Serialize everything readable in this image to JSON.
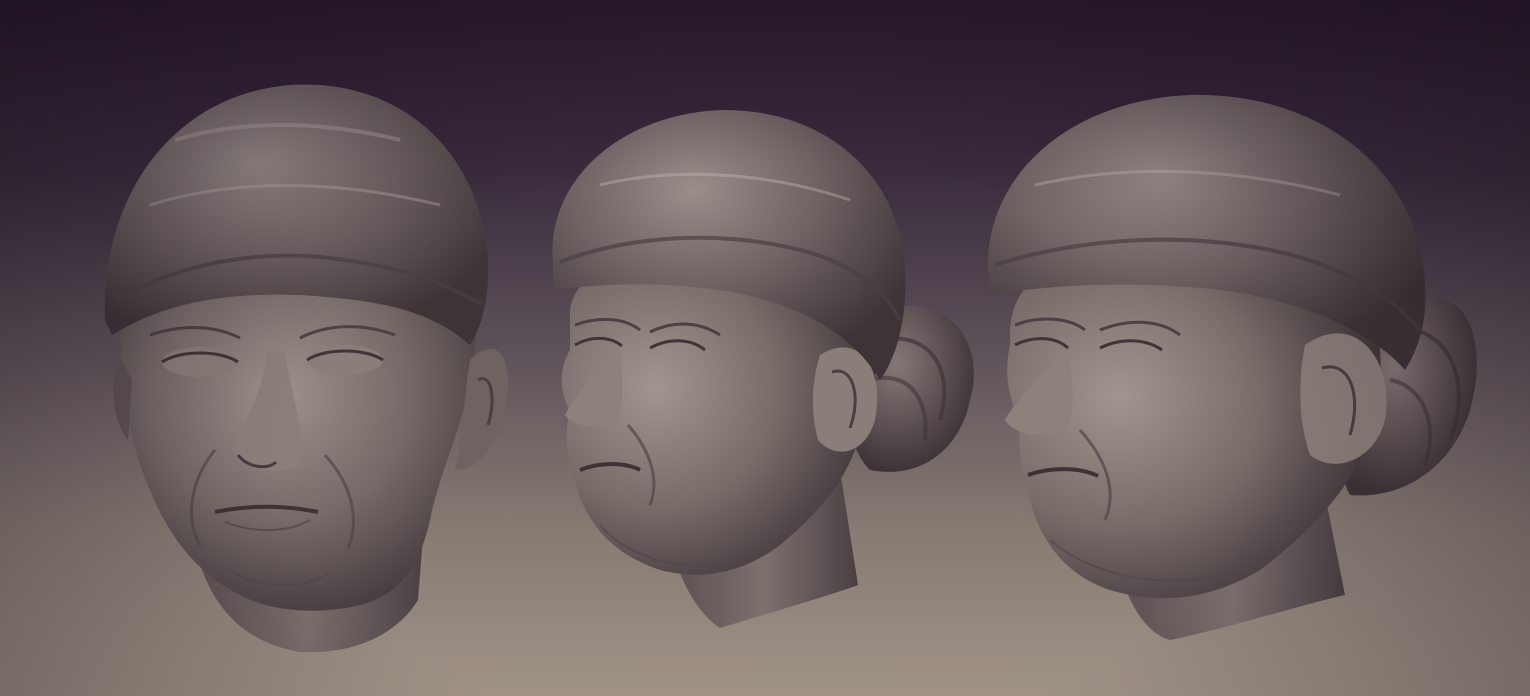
{
  "scene": {
    "description_visible_text": "",
    "background_colors": {
      "top": "#2b1b2e",
      "bottom": "#a09387"
    },
    "clay_color": "#7a6e6c",
    "models": [
      {
        "id": "head-front-view",
        "icon": "sculpted-head-front"
      },
      {
        "id": "head-three-quarter-view",
        "icon": "sculpted-head-three-quarter"
      },
      {
        "id": "head-three-quarter-view-alt",
        "icon": "sculpted-head-three-quarter-alt"
      }
    ]
  }
}
